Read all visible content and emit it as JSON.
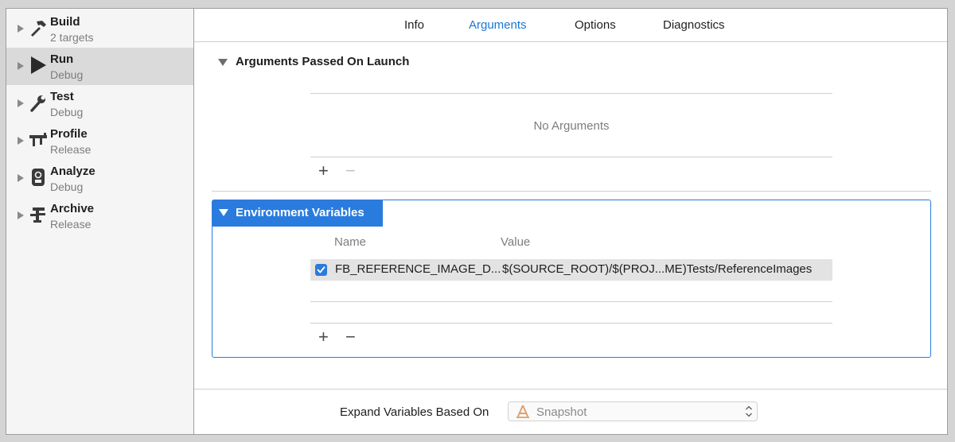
{
  "sidebar": {
    "items": [
      {
        "title": "Build",
        "subtitle": "2 targets",
        "icon": "hammer-icon"
      },
      {
        "title": "Run",
        "subtitle": "Debug",
        "icon": "play-icon"
      },
      {
        "title": "Test",
        "subtitle": "Debug",
        "icon": "wrench-icon"
      },
      {
        "title": "Profile",
        "subtitle": "Release",
        "icon": "instruments-icon"
      },
      {
        "title": "Analyze",
        "subtitle": "Debug",
        "icon": "analyze-icon"
      },
      {
        "title": "Archive",
        "subtitle": "Release",
        "icon": "archive-icon"
      }
    ]
  },
  "tabs": [
    "Info",
    "Arguments",
    "Options",
    "Diagnostics"
  ],
  "active_tab": "Arguments",
  "arguments_section": {
    "title": "Arguments Passed On Launch",
    "empty_text": "No Arguments"
  },
  "env_section": {
    "title": "Environment Variables",
    "col_name": "Name",
    "col_value": "Value",
    "rows": [
      {
        "enabled": true,
        "name": "FB_REFERENCE_IMAGE_D...",
        "value": "$(SOURCE_ROOT)/$(PROJ...ME)Tests/ReferenceImages"
      }
    ]
  },
  "bottom": {
    "expand_label": "Expand Variables Based On",
    "expand_value": "Snapshot"
  },
  "colors": {
    "accent": "#2a7bde",
    "active_tab": "#1a78d2",
    "sidebar_selected": "#dadada"
  }
}
